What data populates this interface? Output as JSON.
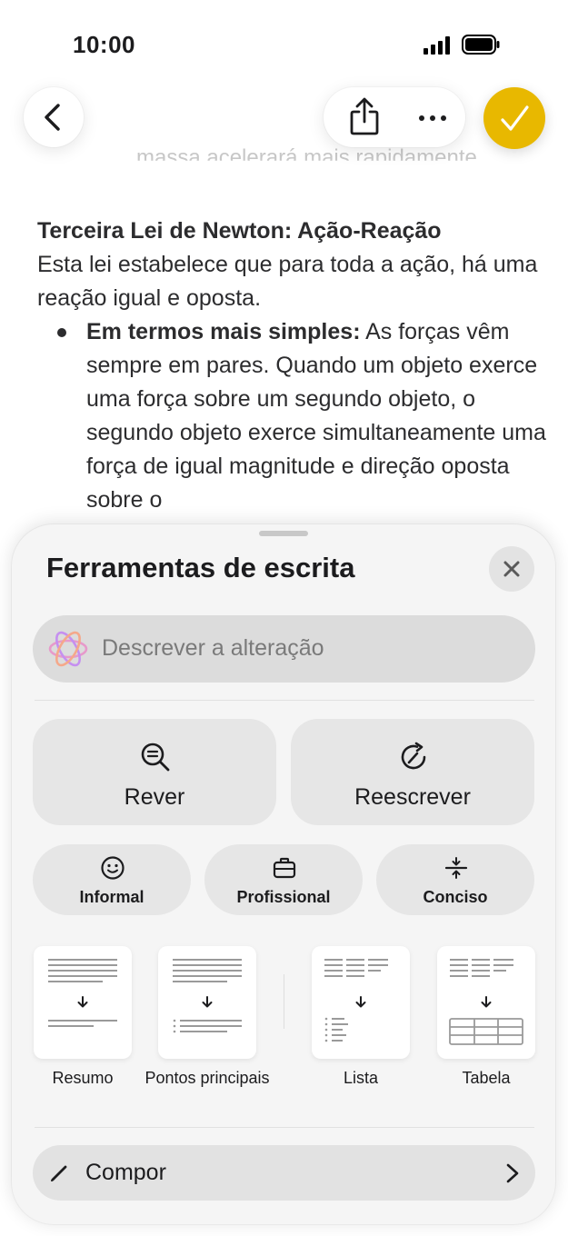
{
  "status_bar": {
    "time": "10:00"
  },
  "document": {
    "faded_line": "massa acelerará mais rapidamente.",
    "heading": "Terceira Lei de Newton: Ação-Reação",
    "intro": "Esta lei estabelece que para toda a ação, há uma reação igual e oposta.",
    "bullet_bold": "Em termos mais simples:",
    "bullet_text": " As forças vêm sempre em pares. Quando um objeto exerce uma força sobre um segundo objeto, o segundo objeto exerce simultaneamente uma força de igual magnitude e direção oposta sobre o"
  },
  "sheet": {
    "title": "Ferramentas de escrita",
    "describe_placeholder": "Descrever a alteração",
    "review_label": "Rever",
    "rewrite_label": "Reescrever",
    "tones": [
      "Informal",
      "Profissional",
      "Conciso"
    ],
    "formats": [
      "Resumo",
      "Pontos principais",
      "Lista",
      "Tabela"
    ],
    "compose_label": "Compor"
  },
  "colors": {
    "accent": "#e8b800",
    "sheet_bg": "#f5f5f5",
    "button_bg": "#e6e6e6"
  },
  "icons": [
    "back-arrow-icon",
    "share-icon",
    "more-icon",
    "checkmark-icon",
    "close-icon",
    "apple-intelligence-icon",
    "magnifier-icon",
    "rewrite-icon",
    "smiley-icon",
    "briefcase-icon",
    "compress-icon",
    "pencil-icon",
    "chevron-right-icon"
  ]
}
